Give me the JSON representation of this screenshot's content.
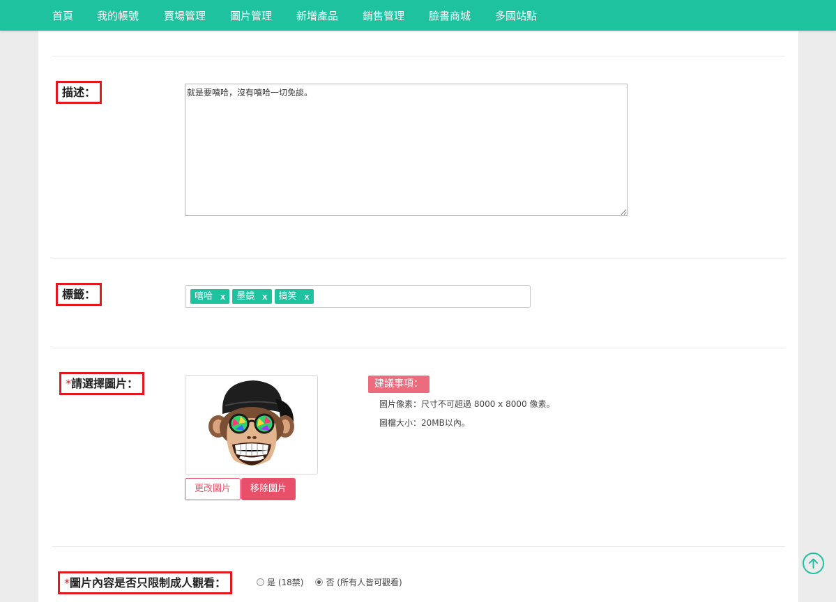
{
  "nav": {
    "items": [
      "首頁",
      "我的帳號",
      "賣場管理",
      "圖片管理",
      "新增產品",
      "銷售管理",
      "臉書商城",
      "多國站點"
    ]
  },
  "form": {
    "description": {
      "label": "描述：",
      "value": "就是要嘻哈，沒有嘻哈一切免談。"
    },
    "tags": {
      "label": "標籤：",
      "items": [
        "嘻哈",
        "墨鏡",
        "搞笑"
      ],
      "remove_glyph": "x"
    },
    "image": {
      "required_mark": "*",
      "label": "請選擇圖片：",
      "change_button": "更改圖片",
      "remove_button": "移除圖片",
      "tips_title": "建議事項：",
      "tips": [
        "圖片像素：尺寸不可超過 8000 x 8000 像素。",
        "圖檔大小：20MB以內。"
      ]
    },
    "adult": {
      "required_mark": "*",
      "label": "圖片內容是否只限制成人觀看：",
      "options": [
        "是 (18禁)",
        "否 (所有人皆可觀看)"
      ],
      "selected_index": 1
    }
  },
  "colors": {
    "brand": "#1fc29e",
    "accent": "#e8506a",
    "highlight": "#e0191f"
  },
  "icons": {
    "scroll_top": "arrow-up-circle-icon"
  }
}
